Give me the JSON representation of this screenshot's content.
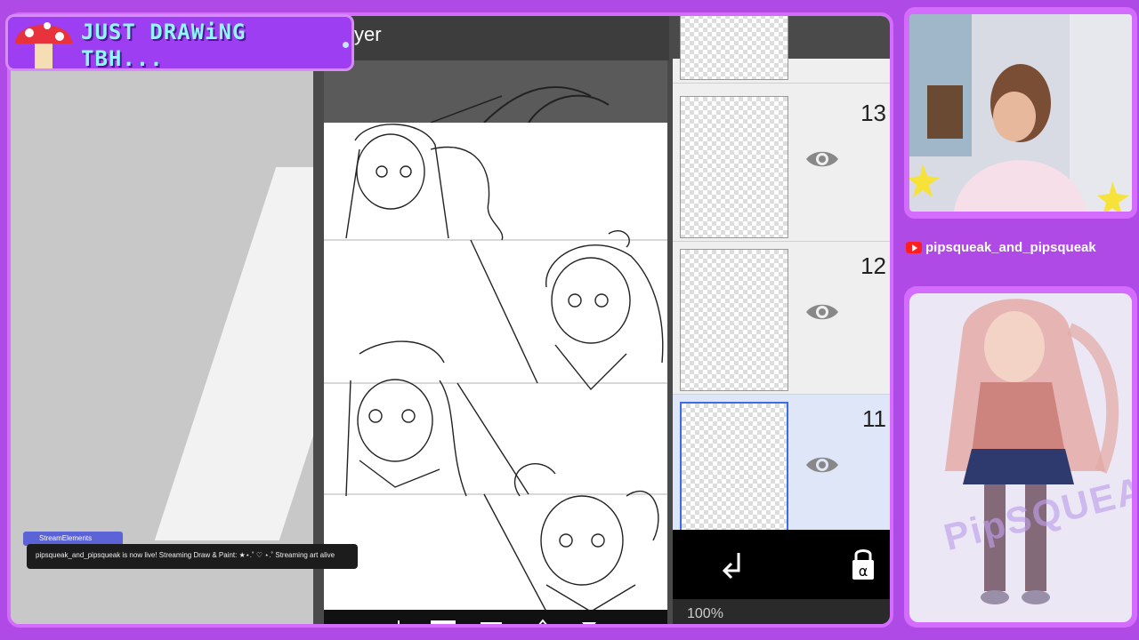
{
  "overlay": {
    "title_line1": "JUST DRAWiNG",
    "title_line2": "TBH...",
    "channel_name": "pipsqueak_and_pipsqueak",
    "avatar_watermark": "PipSQUEAK",
    "colors": {
      "background": "#b04ae6",
      "frame": "#d46cff",
      "title_text": "#8ef7ff"
    }
  },
  "app": {
    "header_partial": "yer",
    "zoom_partial": "100%",
    "layers": [
      {
        "number": "13",
        "selected": false,
        "visible": true
      },
      {
        "number": "12",
        "selected": false,
        "visible": true
      },
      {
        "number": "11",
        "selected": true,
        "visible": true
      }
    ],
    "bottom_icons": [
      "arrow-down-left-icon",
      "alpha-lock-icon"
    ],
    "alpha_lock_label": "α"
  },
  "notification": {
    "tag": "StreamElements",
    "message": "pipsqueak_and_pipsqueak is now live! Streaming Draw & Paint: ★⋆.˚ ♡ ⋆.˚ Streaming art alive"
  }
}
